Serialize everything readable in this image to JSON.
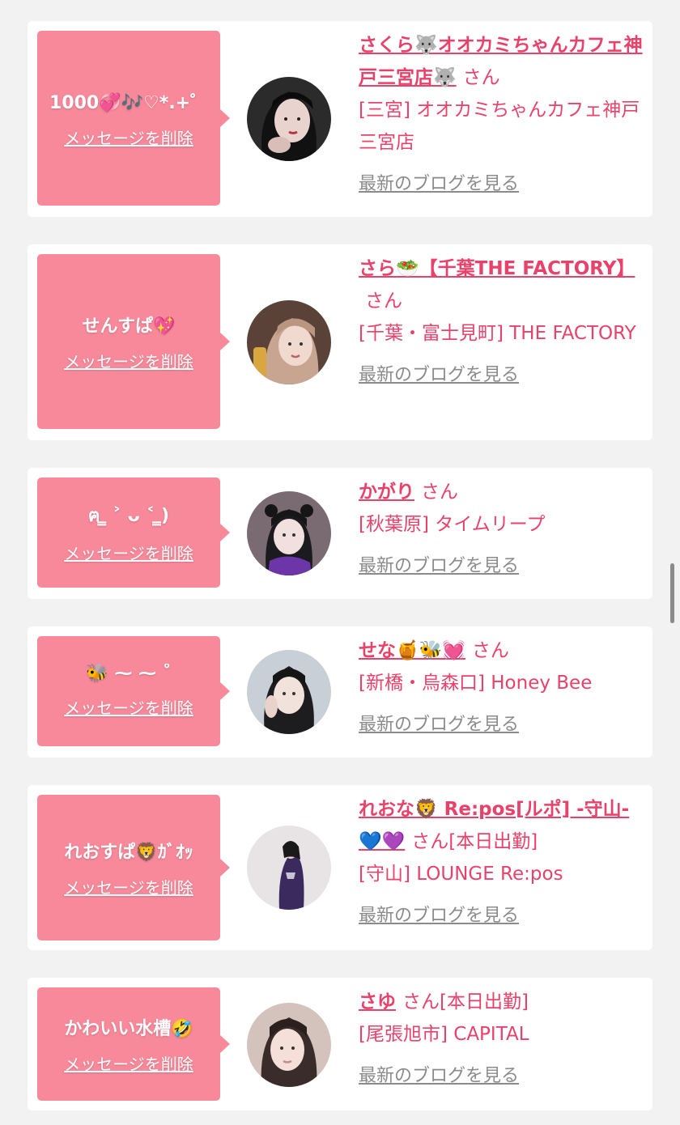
{
  "delete_label": "メッセージを削除",
  "blog_label": "最新のブログを見る",
  "san_label": "さん",
  "colors": {
    "bubble": "#f7899a",
    "accent": "#e8426a",
    "muted": "#8b8b8b",
    "background": "#f2f2f2"
  },
  "cards": [
    {
      "message": "1000💞🎶♡*.+゜",
      "name": "さくら🐺オオカミちゃんカフェ神戸三宮店🐺",
      "suffix": "",
      "store": "[三宮] オオカミちゃんカフェ神戸三宮店",
      "avatar": "avatar-photo"
    },
    {
      "message": "せんすぱ💖",
      "name": "さら🥗【千葉THE FACTORY】",
      "suffix": "",
      "store": "[千葉・富士見町] THE FACTORY",
      "avatar": "avatar-photo"
    },
    {
      "message": "ฅ ̳ ˃ ᴗ ˂ ̳)",
      "name": "かがり",
      "suffix": "",
      "store": "[秋葉原] タイムリープ",
      "avatar": "avatar-photo"
    },
    {
      "message": "🐝 ⁓ ⁓ ˚",
      "name": "せな🍯🐝💓",
      "suffix": "",
      "store": "[新橋・烏森口] Honey Bee",
      "avatar": "avatar-photo"
    },
    {
      "message": "れおすぱ🦁ｶﾞｵｯ",
      "name": "れおな🦁 Re:pos[ルポ] -守山-💙💜",
      "suffix": "[本日出勤]",
      "store": "[守山] LOUNGE Re:pos",
      "avatar": "avatar-photo"
    },
    {
      "message": "かわいい水槽🤣",
      "name": "さゆ",
      "suffix": "[本日出勤]",
      "store": "[尾張旭市] CAPITAL",
      "avatar": "avatar-photo"
    }
  ]
}
